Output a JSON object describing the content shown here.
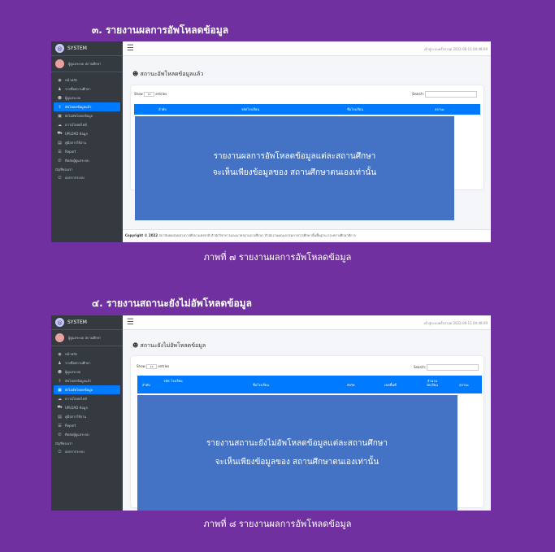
{
  "section1": {
    "heading": "๓. รายงานผลการอัพโหลดข้อมูล",
    "caption": "ภาพที่ ๗ รายงานผลการอัพโหลดข้อมูล",
    "page_title": "สถานะอัพโหลดข้อมูลแล้ว",
    "last_login": "เข้าสู่ระบบครั้งล่าสุด 2022-06-11 04:48:09",
    "columns": [
      "ลำดับ",
      "รหัสโรงเรียน",
      "ชื่อโรงเรียน",
      "สถานะ"
    ],
    "overlay_line1": "รายงานผลการอัพโหลดข้อมูลแต่ละสถานศึกษา",
    "overlay_line2": "จะเห็นเพียงข้อมูลของ สถานศึกษาตนเองเท่านั้น",
    "active_index": 3
  },
  "section2": {
    "heading": "๔. รายงานสถานะยังไม่อัพโหลดข้อมูล",
    "caption": "ภาพที่ ๘ รายงานผลการอัพโหลดข้อมูล",
    "page_title": "สถานะยังไม่อัพโหลดข้อมูล",
    "last_login": "เข้าสู่ระบบครั้งล่าสุด 2022-06-11 04:48:09",
    "columns": [
      "ลำดับ",
      "รหัส โรงเรียน",
      "ชื่อโรงเรียน",
      "สังกัด",
      "เขตพื้นที่",
      "จำนวน นักเรียน",
      "สถานะ"
    ],
    "overlay_line1": "รายงานสถานะยังไม่อัพโหลดข้อมูลแต่ละสถานศึกษา",
    "overlay_line2": "จะเห็นเพียงข้อมูลของ สถานศึกษาตนเองเท่านั้น",
    "active_index": 4
  },
  "app": {
    "brand": "SYSTEM",
    "user_name": "ผู้ดูแลระบบ สถานศึกษา",
    "nav": [
      {
        "icon": "dashboard-icon",
        "glyph": "◉",
        "label": "หน้าหลัก"
      },
      {
        "icon": "user-school-icon",
        "glyph": "♟",
        "label": "รายชื่อสถานศึกษา"
      },
      {
        "icon": "users-icon",
        "glyph": "☻",
        "label": "ผู้ดูแลระบบ"
      },
      {
        "icon": "upload-icon",
        "glyph": "⇪",
        "label": "อัพโหลดข้อมูลแล้ว"
      },
      {
        "icon": "not-uploaded-icon",
        "glyph": "▣",
        "label": "ยังไม่อัพโหลดข้อมูล"
      },
      {
        "icon": "cloud-download-icon",
        "glyph": "☁",
        "label": "ดาวน์โหลดไฟล์"
      },
      {
        "icon": "cart-icon",
        "glyph": "⛟",
        "label": "UPLOAD ข้อมูล"
      },
      {
        "icon": "book-icon",
        "glyph": "▤",
        "label": "คู่มือการใช้งาน"
      },
      {
        "icon": "report-icon",
        "glyph": "☰",
        "label": "Report"
      },
      {
        "icon": "contact-icon",
        "glyph": "✆",
        "label": "ติดต่อผู้ดูแลระบบ"
      }
    ],
    "nav_header": "บัญชีของเรา",
    "logout": {
      "icon": "logout-icon",
      "glyph": "⏻",
      "label": "ออกจากระบบ"
    },
    "show_label": "Show",
    "entries_value": "10",
    "entries_label": "entries",
    "search_label": "Search:",
    "footer_bold": "Copyright © 2022",
    "footer_text": "สถาบันทดสอบทางการศึกษาแห่งชาติ สำนักวิชาการและมาตรฐานการศึกษา สำนักงานคณะกรรมการการศึกษาขั้นพื้นฐาน กระทรวงศึกษาธิการ"
  }
}
